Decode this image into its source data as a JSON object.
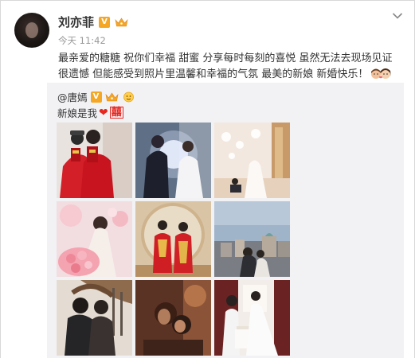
{
  "post": {
    "author_name": "刘亦菲",
    "verified_label": "V",
    "timestamp": "今天 11:42",
    "text": "最亲爱的糖糖 祝你们幸福 甜蜜 分享每时每刻的喜悦 虽然无法去现场见证很遗憾 但能感受到照片里温馨和幸福的气氛 最美的新娘 新婚快乐！"
  },
  "repost": {
    "mention": "@唐嫣",
    "verified_label": "V",
    "text": "新娘是我",
    "xi_char": "囍"
  },
  "icons": {
    "more": "chevron-down-icon",
    "verified": "verified-v-icon",
    "member": "crown-icon",
    "heart": "red-heart-icon"
  },
  "colors": {
    "accent_orange": "#f5a623",
    "heart_red": "#e8271f",
    "repost_bg": "#f2f2f5"
  },
  "photos": [
    {
      "desc": "photo-1"
    },
    {
      "desc": "photo-2"
    },
    {
      "desc": "photo-3"
    },
    {
      "desc": "photo-4"
    },
    {
      "desc": "photo-5"
    },
    {
      "desc": "photo-6"
    },
    {
      "desc": "photo-7"
    },
    {
      "desc": "photo-8"
    },
    {
      "desc": "photo-9"
    }
  ]
}
